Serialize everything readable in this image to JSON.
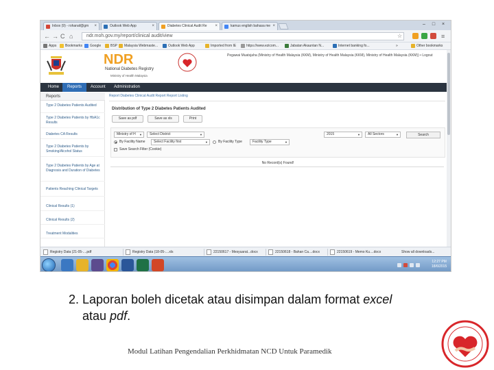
{
  "browser": {
    "tabs": [
      {
        "label": "Inbox (9) - rohanaf@gm"
      },
      {
        "label": "Outlook Web App"
      },
      {
        "label": "Diabetes Clinical Audit Re"
      },
      {
        "label": "kamus english bahasa me"
      }
    ],
    "address": "ndr.moh.gov.my/report/clinical audit/view",
    "bookmarks": [
      {
        "label": "Apps"
      },
      {
        "label": "Bookmarks"
      },
      {
        "label": "Google"
      },
      {
        "label": "BSP"
      },
      {
        "label": "Malaysia Webmaste..."
      },
      {
        "label": "Outlook Web App"
      },
      {
        "label": "Imported from IE"
      },
      {
        "label": "https://www.ezicom..."
      },
      {
        "label": "Jabatan Akauntan N..."
      },
      {
        "label": "Internet banking fo..."
      },
      {
        "label": "»"
      },
      {
        "label": "Other bookmarks"
      }
    ]
  },
  "site": {
    "logo_text": "NDR",
    "logo_name": "National Diabetes Registry",
    "logo_ministry": "Ministry of Health Malaysia",
    "user_info": "Pegawai Muatsjaha (Ministry of Health Malaysia (KKM), Ministry of Health Malaysia (KKM), Ministry of Health Malaysia (KKM)) • Logout",
    "nav": [
      {
        "label": "Home"
      },
      {
        "label": "Reports"
      },
      {
        "label": "Account"
      },
      {
        "label": "Administration"
      }
    ]
  },
  "sidebar": {
    "header": "Reports",
    "items": [
      {
        "label": "Type 2 Diabetes Patients Audited"
      },
      {
        "label": "Type 2 Diabetes Patients by HbA1c Results"
      },
      {
        "label": "Diabetes CA Results"
      },
      {
        "label": "Type 2 Diabetes Patients by Smoking/Alcohol Status"
      },
      {
        "label": "Type 2 Diabetes Patients by Age at Diagnosis and Duration of Diabetes"
      },
      {
        "label": "Patients Reaching Clinical Targets"
      },
      {
        "label": "Clinical Results (1)"
      },
      {
        "label": "Clinical Results (2)"
      },
      {
        "label": "Treatment Modalities"
      }
    ]
  },
  "content": {
    "breadcrumb": "Report   Diabetes Clinical Audit Report   Report Listing",
    "title": "Distribution of Type 2 Diabetes Patients Audited",
    "buttons": {
      "save_pdf": "Save as pdf",
      "save_xls": "Save as xls",
      "print": "Print"
    },
    "filters": {
      "ministry": "Ministry of H",
      "district": "Select District",
      "by_facility_name": "By Facility Name",
      "facility_name_value": "Select Facility first",
      "by_facility_type": "By Facility Type",
      "facility_type_value": "Facility Type",
      "year": "2015",
      "sector": "All Sectors",
      "search": "Search",
      "save_search_filter": "Save Search Filter (Cookie)"
    },
    "no_result": "No Record(s) Found!"
  },
  "downloads": [
    {
      "label": "Registry Data (21-05-....pdf"
    },
    {
      "label": "Registry Data (18-05-....xls"
    },
    {
      "label": "22150617 - Mesyuarat...docx"
    },
    {
      "label": "22150618 - Bahan Ca....docx"
    },
    {
      "label": "22150619 - Memo Ku....docx"
    }
  ],
  "downloads_showall": "Show all downloads...",
  "taskbar": {
    "time": "12:27 PM",
    "date": "18/6/2015"
  },
  "slide": {
    "num": "2.",
    "t1": " Laporan boleh di",
    "w1": "cetak",
    "t2": " atau di",
    "w2": "simpan",
    "t3": " dalam format ",
    "w3": "excel",
    "t4": "atau ",
    "w4": "pdf",
    "t5": ".",
    "footer": "Modul Latihan Pengendalian Perkhidmatan NCD Untuk Paramedik"
  },
  "colors": {
    "nav_bg": "#2b3440",
    "nav_active": "#2f6db5",
    "link": "#2f5d8a",
    "ndr_orange": "#f0a023",
    "badge_red": "#d8262a"
  }
}
